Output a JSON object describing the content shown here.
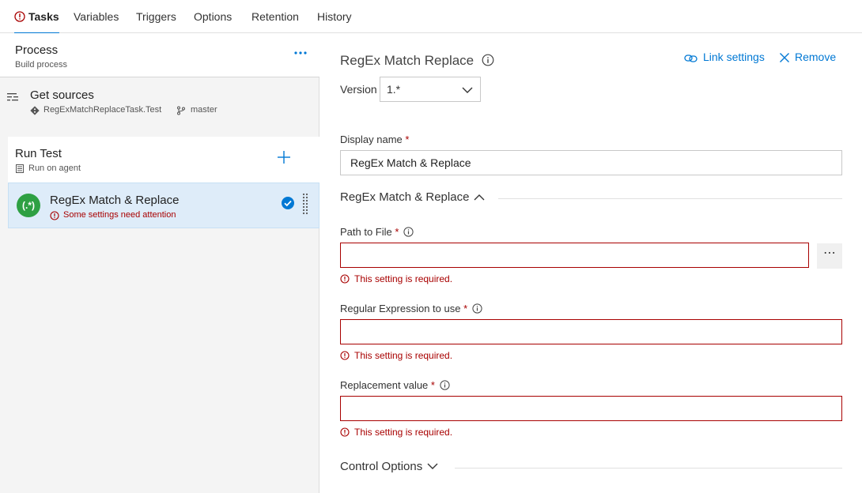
{
  "tabs": [
    {
      "label": "Tasks",
      "active": true,
      "has_error": true
    },
    {
      "label": "Variables"
    },
    {
      "label": "Triggers"
    },
    {
      "label": "Options"
    },
    {
      "label": "Retention"
    },
    {
      "label": "History"
    }
  ],
  "process": {
    "title": "Process",
    "subtitle": "Build process",
    "more_icon": "ellipsis-icon"
  },
  "get_sources": {
    "title": "Get sources",
    "repo": "RegExMatchReplaceTask.Test",
    "branch": "master"
  },
  "run_test": {
    "title": "Run Test",
    "subtitle": "Run on agent"
  },
  "task": {
    "logo_text": "(.*)",
    "title": "RegEx Match & Replace",
    "warning": "Some settings need attention"
  },
  "detail": {
    "title": "RegEx Match Replace",
    "link_settings": "Link settings",
    "remove": "Remove",
    "version_label": "Version",
    "version_value": "1.*",
    "display_name_label": "Display name",
    "display_name_value": "RegEx Match & Replace",
    "section_title": "RegEx Match & Replace",
    "path_label": "Path to File",
    "regex_label": "Regular Expression to use",
    "replacement_label": "Replacement value",
    "required_marker": "*",
    "required_error": "This setting is required.",
    "browse_button": "⋯",
    "control_options": "Control Options"
  },
  "colors": {
    "accent": "#0078d4",
    "error": "#a80000",
    "selected_bg": "#deecf9",
    "task_logo": "#2ea043"
  }
}
